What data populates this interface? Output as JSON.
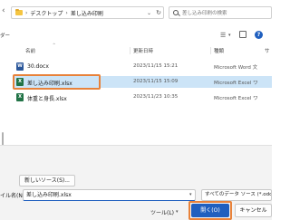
{
  "address": {
    "crumbs": [
      "デスクトップ",
      "差し込み印刷"
    ],
    "search_placeholder": "差し込み印刷の検索"
  },
  "toolbar": {
    "left_label": "ダー"
  },
  "columns": {
    "name": "名前",
    "modified": "更新日時",
    "type": "種類",
    "size": "サ"
  },
  "files": [
    {
      "name": "30.docx",
      "modified": "2023/11/15 15:21",
      "type": "Microsoft Word 文",
      "size": "",
      "kind": "word"
    },
    {
      "name": "差し込み印刷.xlsx",
      "modified": "2023/11/15 15:09",
      "type": "Microsoft Excel ワ",
      "size": "",
      "kind": "excel",
      "selected": true
    },
    {
      "name": "体重と身長.xlsx",
      "modified": "2023/11/23 10:35",
      "type": "Microsoft Excel ワ",
      "size": "",
      "kind": "excel"
    }
  ],
  "bottom": {
    "new_source_label": "新しいソース(S)...",
    "filename_label": "イル名(N):",
    "filename_value": "差し込み印刷.xlsx",
    "filter_value": "すべてのデータ ソース (*.odc;*.mdb;",
    "tools_label": "ツール(L)",
    "open_label": "開く(O)",
    "cancel_label": "キャンセル"
  },
  "colors": {
    "accent": "#1f5fbf",
    "highlight": "#e8823a",
    "selected_row": "#cce4f7"
  }
}
